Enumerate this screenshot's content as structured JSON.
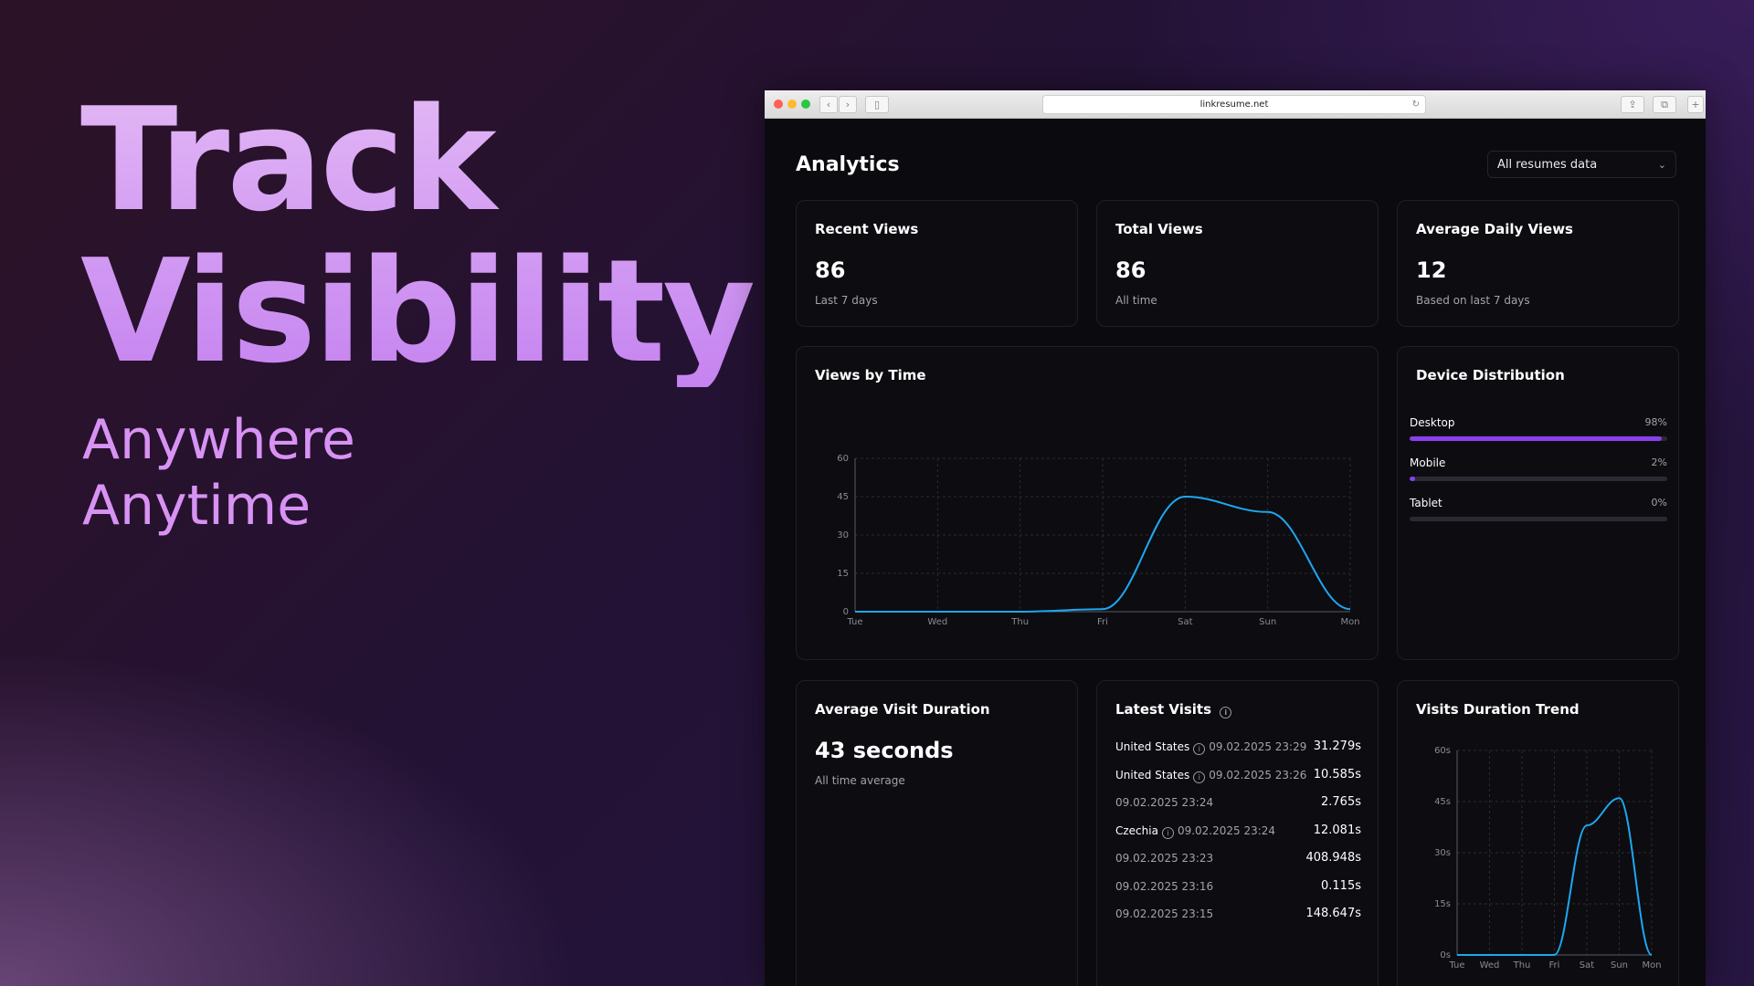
{
  "hero": {
    "title_line1": "Track",
    "title_line2": "Visibility",
    "subtitle_line1": "Anywhere",
    "subtitle_line2": "Anytime"
  },
  "browser": {
    "url": "linkresume.net",
    "back_glyph": "‹",
    "forward_glyph": "›",
    "reload_glyph": "↻",
    "share_glyph": "⇪",
    "tabs_glyph": "⧉",
    "newtab_glyph": "+",
    "sidebar_glyph": "▯"
  },
  "page": {
    "title": "Analytics",
    "filter_value": "All resumes data",
    "filter_chevron": "⌄"
  },
  "stats": {
    "recent": {
      "title": "Recent Views",
      "value": "86",
      "sub": "Last 7 days"
    },
    "total": {
      "title": "Total Views",
      "value": "86",
      "sub": "All time"
    },
    "daily": {
      "title": "Average Daily Views",
      "value": "12",
      "sub": "Based on last 7 days"
    }
  },
  "views_chart": {
    "title": "Views by Time"
  },
  "device": {
    "title": "Device Distribution",
    "items": [
      {
        "label": "Desktop",
        "pct_text": "98%",
        "fraction": 0.98
      },
      {
        "label": "Mobile",
        "pct_text": "2%",
        "fraction": 0.02
      },
      {
        "label": "Tablet",
        "pct_text": "0%",
        "fraction": 0
      }
    ]
  },
  "avg_duration": {
    "title": "Average Visit Duration",
    "value": "43 seconds",
    "sub": "All time average"
  },
  "latest": {
    "title": "Latest Visits",
    "info_glyph": "i",
    "rows": [
      {
        "country": "United States",
        "time": "09.02.2025 23:29",
        "duration": "31.279s"
      },
      {
        "country": "United States",
        "time": "09.02.2025 23:26",
        "duration": "10.585s"
      },
      {
        "country": "",
        "time": "09.02.2025 23:24",
        "duration": "2.765s"
      },
      {
        "country": "Czechia",
        "time": "09.02.2025 23:24",
        "duration": "12.081s"
      },
      {
        "country": "",
        "time": "09.02.2025 23:23",
        "duration": "408.948s"
      },
      {
        "country": "",
        "time": "09.02.2025 23:16",
        "duration": "0.115s"
      },
      {
        "country": "",
        "time": "09.02.2025 23:15",
        "duration": "148.647s"
      }
    ]
  },
  "trend_chart": {
    "title": "Visits Duration Trend"
  },
  "chart_data": [
    {
      "type": "line",
      "title": "Views by Time",
      "x": [
        "Tue",
        "Wed",
        "Thu",
        "Fri",
        "Sat",
        "Sun",
        "Mon"
      ],
      "values": [
        0,
        0,
        0,
        1,
        45,
        39,
        1
      ],
      "yticks": [
        "0",
        "15",
        "30",
        "45",
        "60"
      ],
      "ylim": [
        0,
        60
      ],
      "grid": true,
      "color": "#1ea7f0"
    },
    {
      "type": "line",
      "title": "Visits Duration Trend",
      "x": [
        "Tue",
        "Wed",
        "Thu",
        "Fri",
        "Sat",
        "Sun",
        "Mon"
      ],
      "values": [
        0,
        0,
        0,
        0,
        38,
        46,
        0
      ],
      "yticks": [
        "0s",
        "15s",
        "30s",
        "45s",
        "60s"
      ],
      "ylim": [
        0,
        60
      ],
      "grid": true,
      "color": "#1ea7f0"
    }
  ]
}
